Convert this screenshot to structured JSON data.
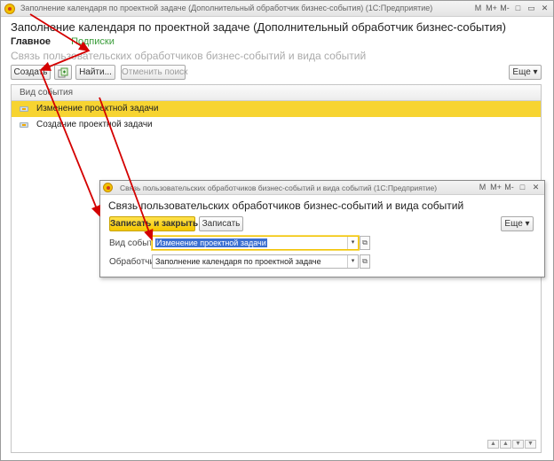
{
  "window": {
    "title": "Заполнение календаря по проектной задаче (Дополнительный обработчик бизнес-события) (1С:Предприятие)",
    "controls": [
      "M",
      "M+",
      "M-",
      "□",
      "▭",
      "✕"
    ]
  },
  "form": {
    "heading": "Заполнение календаря по проектной задаче (Дополнительный обработчик бизнес-события)",
    "nav_main": "Главное",
    "nav_link": "Подписки",
    "subheading": "Связь пользовательских обработчиков бизнес-событий и вида событий"
  },
  "toolbar": {
    "create": "Создать",
    "find": "Найти...",
    "cancel_search": "Отменить поиск",
    "more": "Еще ▾"
  },
  "list": {
    "column": "Вид события",
    "rows": [
      {
        "label": "Изменение проектной задачи",
        "selected": true
      },
      {
        "label": "Создание проектной задачи",
        "selected": false
      }
    ],
    "pager": [
      "▲",
      "▲",
      "▼",
      "▼"
    ]
  },
  "dialog": {
    "title": "Связь пользовательских обработчиков бизнес-событий и вида событий (1С:Предприятие)",
    "heading": "Связь пользовательских обработчиков бизнес-событий и вида событий",
    "save_close": "Записать и закрыть",
    "save": "Записать",
    "more": "Еще ▾",
    "event_label": "Вид события:",
    "event_value": "Изменение проектной задачи",
    "handler_label": "Обработчик:",
    "handler_value": "Заполнение календаря по проектной задаче",
    "controls": [
      "M",
      "M+",
      "M-",
      "□",
      "✕"
    ]
  },
  "colors": {
    "selection": "#f7d431",
    "accent_button": "#f5c800",
    "arrow": "#d40000",
    "link": "#3a9d3a"
  }
}
